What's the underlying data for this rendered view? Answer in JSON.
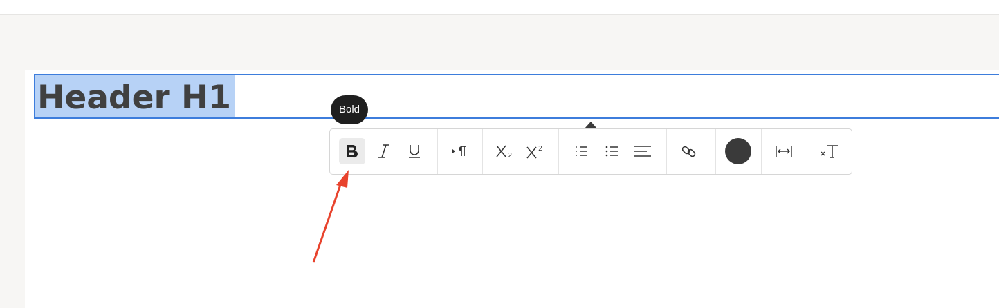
{
  "editor": {
    "heading_text": "Header H1"
  },
  "tooltip": {
    "text": "Bold"
  },
  "toolbar": {
    "buttons": [
      {
        "name": "bold",
        "icon": "bold-icon",
        "active": true
      },
      {
        "name": "italic",
        "icon": "italic-icon"
      },
      {
        "name": "underline",
        "icon": "underline-icon"
      },
      {
        "name": "paragraph",
        "icon": "paragraph-icon"
      },
      {
        "name": "subscript",
        "icon": "subscript-icon"
      },
      {
        "name": "superscript",
        "icon": "superscript-icon"
      },
      {
        "name": "ordered-list",
        "icon": "ordered-list-icon"
      },
      {
        "name": "bulleted-list",
        "icon": "bulleted-list-icon"
      },
      {
        "name": "align",
        "icon": "align-left-icon"
      },
      {
        "name": "link",
        "icon": "link-icon"
      },
      {
        "name": "text-color",
        "icon": "color-swatch",
        "color": "#3a3a3a"
      },
      {
        "name": "letter-spacing",
        "icon": "letter-spacing-icon"
      },
      {
        "name": "clear-formatting",
        "icon": "clear-formatting-icon"
      }
    ]
  },
  "colors": {
    "selection": "#b7d2f6",
    "focus_border": "#3d7ddc",
    "annotation_arrow": "#e8432d",
    "tooltip_bg": "#1f1f1f"
  }
}
